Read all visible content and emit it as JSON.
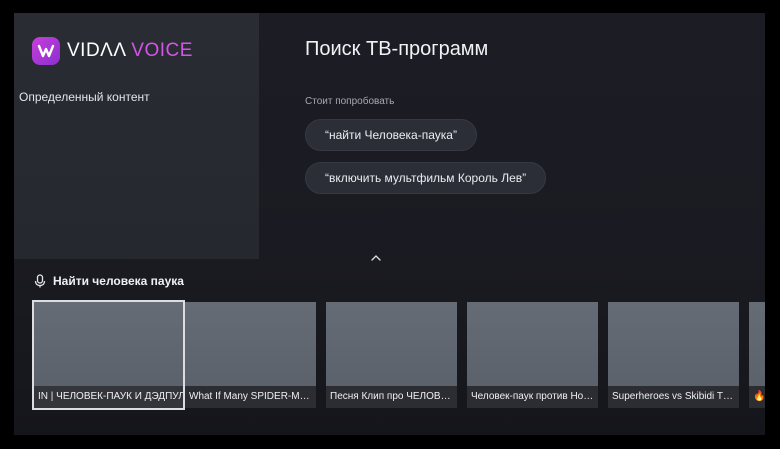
{
  "brand": {
    "name_prefix": "VIDΛΛ",
    "name_suffix": "VOICE",
    "accent": "#c640d8"
  },
  "sidebar": {
    "items": [
      {
        "label": "Определенный контент"
      }
    ]
  },
  "main": {
    "title": "Поиск ТВ-программ",
    "try_label": "Стоит попробовать",
    "suggestions": [
      {
        "label": "“найти Человека-паука”"
      },
      {
        "label": "“включить мультфильм Король Лев”"
      }
    ]
  },
  "results": {
    "query": "Найти человека паука",
    "items": [
      {
        "title": "IN | ЧЕЛОВЕК-ПАУК И ДЭДПУЛ"
      },
      {
        "title": "What If Many SPIDER-MA…"
      },
      {
        "title": "Песня Клип про ЧЕЛОВЕК…"
      },
      {
        "title": "Человек-паук против Но…"
      },
      {
        "title": "Superheroes vs Skibidi T…"
      },
      {
        "title": "🔥"
      }
    ]
  }
}
